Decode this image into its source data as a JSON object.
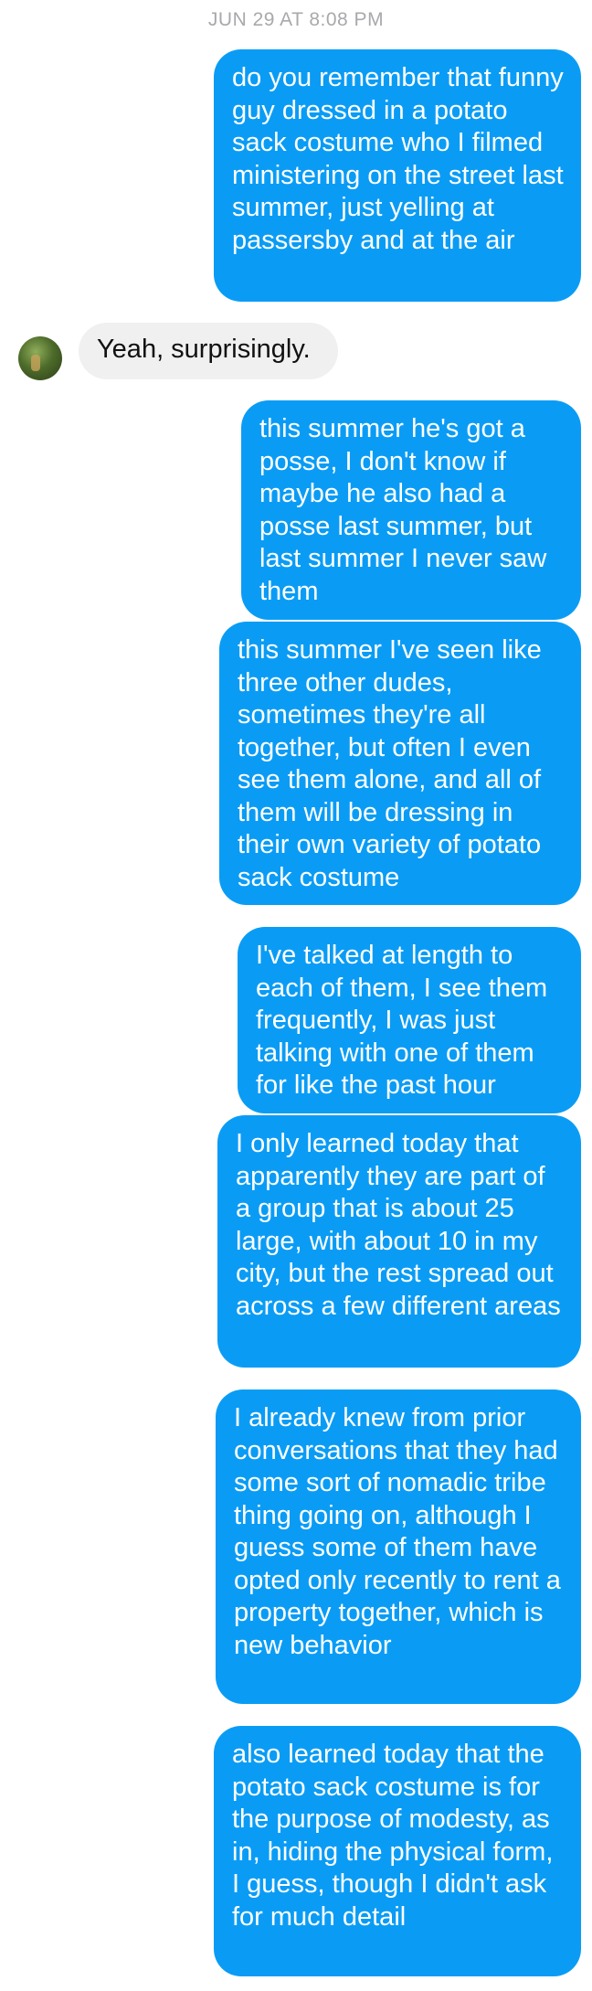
{
  "timestamp": "JUN 29 AT 8:08 PM",
  "messages": [
    {
      "from": "me",
      "text": "do you remember that funny guy dressed in a potato sack costume who I filmed ministering on the street last summer, just yelling at passersby and at the air"
    },
    {
      "from": "them",
      "text": "Yeah, surprisingly."
    },
    {
      "from": "me",
      "text": "this summer he's got a posse, I don't know if maybe he also had a posse last summer, but last summer I never saw them"
    },
    {
      "from": "me",
      "text": "this summer I've seen like three other dudes, sometimes they're all together, but often I even see them alone, and all of them will be dressing in their own variety of potato sack costume"
    },
    {
      "from": "me",
      "text": "I've talked at length to each of them, I see them frequently, I was just talking with one of them for like the past hour"
    },
    {
      "from": "me",
      "text": "I only learned today that apparently they are part of a group that is about 25 large, with about 10 in my city, but the rest spread out across a few different areas"
    },
    {
      "from": "me",
      "text": "I already knew from prior conversations that they had some sort of nomadic tribe thing going on, although I guess some of them have opted only recently to rent a property together, which is new behavior"
    },
    {
      "from": "me",
      "text": "also learned today that the potato sack costume is for the purpose of modesty, as in, hiding the physical form, I guess, though I didn't ask for much detail"
    }
  ],
  "colors": {
    "sent_bubble": "#0a9cf5",
    "received_bubble": "#f0f0f0",
    "timestamp_text": "#a9a9ad"
  }
}
